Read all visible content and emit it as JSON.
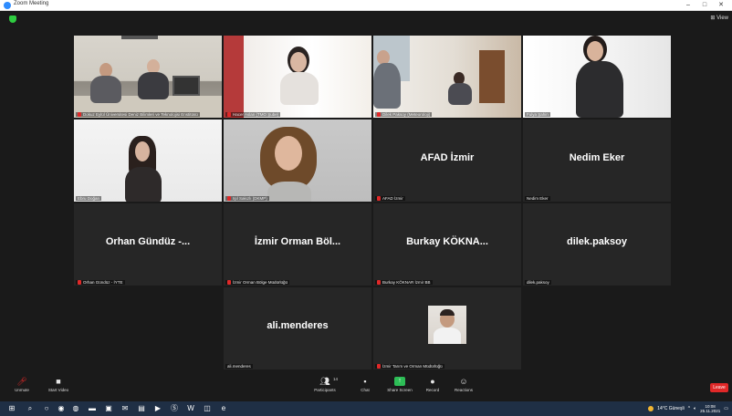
{
  "window": {
    "title": "Zoom Meeting",
    "minimize": "–",
    "maximize": "□",
    "close": "✕"
  },
  "view_button": "⊞ View",
  "tiles": [
    {
      "label": "Dokuz Eylül Üniversitesi Deniz Bilimleri ve Teknolojisi Enstitüsü",
      "muted": true
    },
    {
      "label": "Hacer Aslan (TMO Şube)",
      "muted": true
    },
    {
      "label": "Dilek Paksoy (Meteoroloji)",
      "muted": true
    },
    {
      "label": "Fulya Şahin",
      "muted": false
    },
    {
      "label": "Ebru Doğan",
      "muted": false
    },
    {
      "label": "Işıl Sakızlı (DKMP)",
      "muted": true
    },
    {
      "big_name": "AFAD İzmir",
      "label": "AFAD İzmir",
      "muted": true
    },
    {
      "big_name": "Nedim Eker",
      "label": "Nedim Eker",
      "muted": false
    },
    {
      "big_name": "Orhan Gündüz -...",
      "label": "Orhan Gündüz - İYTE",
      "muted": true
    },
    {
      "big_name": "İzmir Orman Böl...",
      "label": "İzmir Orman Bölge Müdürlüğü",
      "muted": true
    },
    {
      "big_name": "Burkay KÖKNA...",
      "label": "Burkay KÖKNAR İzmir BB",
      "muted": true
    },
    {
      "big_name": "dilek.paksoy",
      "label": "dilek.paksoy",
      "muted": false
    },
    {
      "big_name": "ali.menderes",
      "label": "ali.menderes",
      "muted": false
    },
    {
      "label": "İzmir Tarım ve Orman Müdürlüğü",
      "muted": true
    }
  ],
  "toolbar": {
    "unmute": "Unmute",
    "start_video": "Start Video",
    "participants": "Participants",
    "participants_count": "14",
    "chat": "Chat",
    "share_screen": "Share Screen",
    "record": "Record",
    "reactions": "Reactions",
    "leave": "Leave"
  },
  "taskbar": {
    "weather": "14°C Güneşli",
    "time": "10:08",
    "date": "25.11.2021"
  },
  "colors": {
    "active_speaker": "#c7e36a",
    "leave": "#e02828",
    "share": "#2dbd56",
    "taskbar": "#1f2f45"
  }
}
